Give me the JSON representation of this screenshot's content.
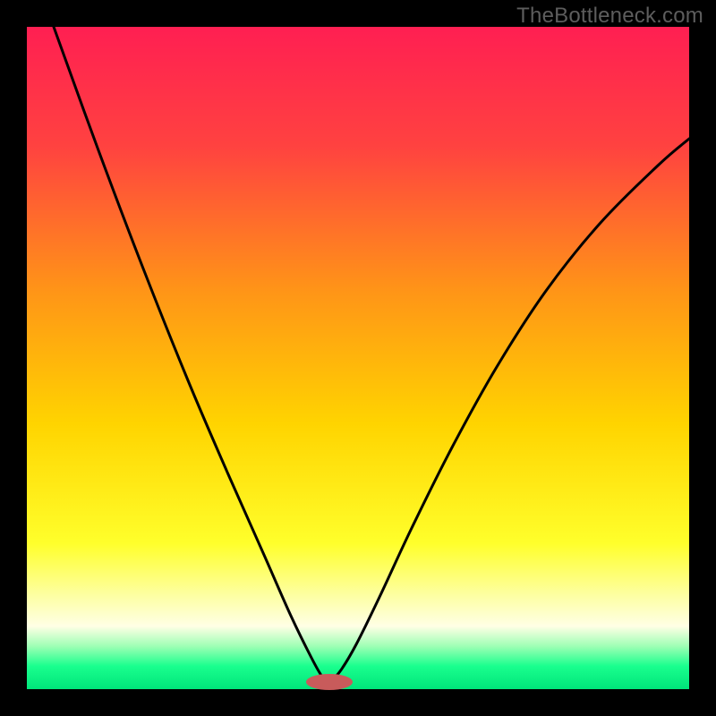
{
  "watermark": "TheBottleneck.com",
  "frame": {
    "outer_size": 800,
    "border": 30,
    "inner_color_stops": [
      {
        "offset": 0.0,
        "color": "#ff1f52"
      },
      {
        "offset": 0.18,
        "color": "#ff4240"
      },
      {
        "offset": 0.4,
        "color": "#ff9517"
      },
      {
        "offset": 0.6,
        "color": "#ffd400"
      },
      {
        "offset": 0.78,
        "color": "#ffff2b"
      },
      {
        "offset": 0.86,
        "color": "#fdffa5"
      },
      {
        "offset": 0.905,
        "color": "#ffffe5"
      },
      {
        "offset": 0.935,
        "color": "#9fffb5"
      },
      {
        "offset": 0.965,
        "color": "#1aff8e"
      },
      {
        "offset": 1.0,
        "color": "#00e57a"
      }
    ]
  },
  "marker": {
    "cx": 368,
    "cy": 762,
    "rx": 26,
    "ry": 9,
    "fill": "#c85b5b"
  },
  "chart_data": {
    "type": "line",
    "title": "",
    "xlabel": "",
    "ylabel": "",
    "xlim": [
      30,
      770
    ],
    "ylim": [
      30,
      770
    ],
    "series": [
      {
        "name": "left-branch",
        "points": [
          [
            60,
            30
          ],
          [
            110,
            168
          ],
          [
            160,
            300
          ],
          [
            210,
            425
          ],
          [
            255,
            530
          ],
          [
            295,
            620
          ],
          [
            325,
            688
          ],
          [
            348,
            735
          ],
          [
            360,
            756
          ],
          [
            368,
            762
          ]
        ]
      },
      {
        "name": "right-branch",
        "points": [
          [
            368,
            762
          ],
          [
            380,
            750
          ],
          [
            398,
            720
          ],
          [
            425,
            665
          ],
          [
            460,
            590
          ],
          [
            505,
            500
          ],
          [
            555,
            410
          ],
          [
            610,
            325
          ],
          [
            670,
            250
          ],
          [
            735,
            185
          ],
          [
            770,
            155
          ]
        ]
      }
    ],
    "marker_point": {
      "x": 368,
      "y": 762
    }
  }
}
